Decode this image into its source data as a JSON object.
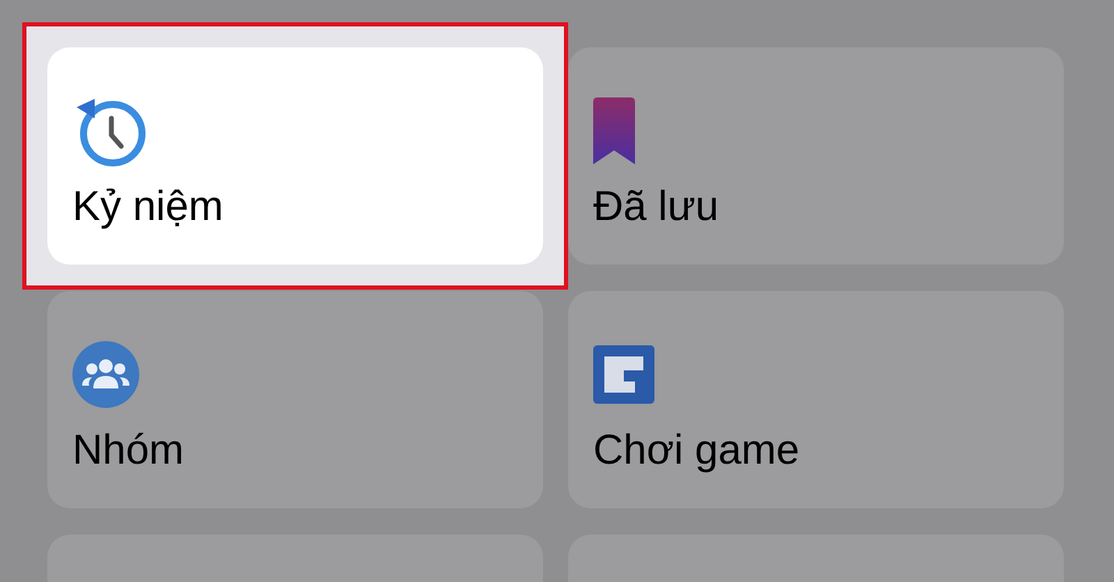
{
  "tiles": [
    {
      "kind": "memories",
      "label": "Kỷ niệm",
      "highlighted": true
    },
    {
      "kind": "saved",
      "label": "Đã lưu",
      "highlighted": false
    },
    {
      "kind": "groups",
      "label": "Nhóm",
      "highlighted": false
    },
    {
      "kind": "gaming",
      "label": "Chơi game",
      "highlighted": false
    },
    {
      "kind": "blank",
      "highlighted": false
    },
    {
      "kind": "blank",
      "highlighted": false
    }
  ]
}
